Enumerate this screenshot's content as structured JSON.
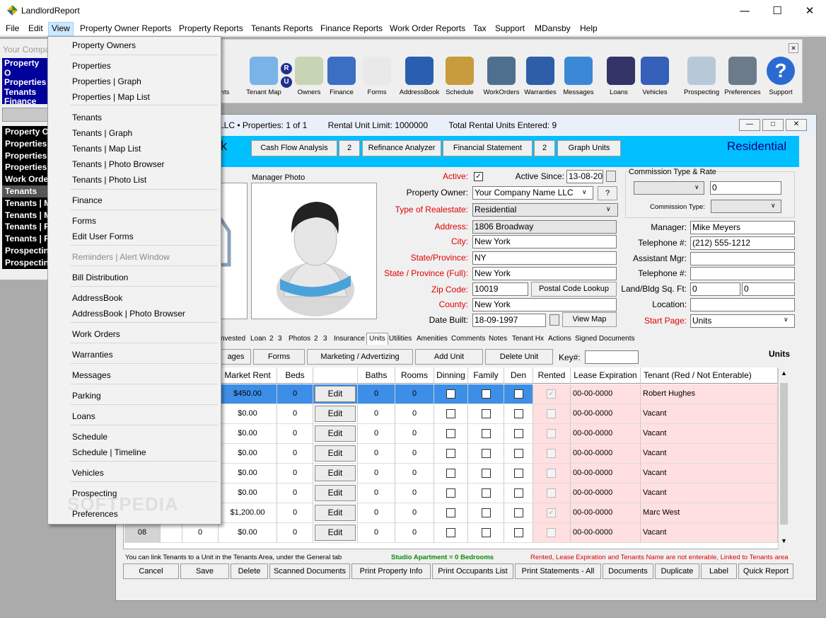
{
  "window": {
    "title": "LandlordReport"
  },
  "menu": {
    "items": [
      "File",
      "Edit",
      "View",
      "Property Owner Reports",
      "Property Reports",
      "Tenants Reports",
      "Finance Reports",
      "Work Order Reports",
      "Tax",
      "Support",
      "MDansby",
      "Help"
    ]
  },
  "view_menu": {
    "items": [
      "Property Owners",
      "Properties",
      "Properties | Graph",
      "Properties | Map List",
      "Tenants",
      "Tenants | Graph",
      "Tenants | Map List",
      "Tenants | Photo Browser",
      "Tenants | Photo List",
      "Finance",
      "Forms",
      "Edit User Forms",
      "Reminders | Alert Window",
      "Bill Distribution",
      "AddressBook",
      "AddressBook | Photo Browser",
      "Work Orders",
      "Warranties",
      "Messages",
      "Parking",
      "Loans",
      "Schedule",
      "Schedule | Timeline",
      "Vehicles",
      "Prospecting",
      "Preferences"
    ]
  },
  "left_panel": {
    "company_placeholder": "Your Compa",
    "list1": [
      "Property O",
      "Properties",
      "Tenants",
      "Finance"
    ],
    "list2": [
      "Property O",
      "Properties",
      "Properties",
      "Properties",
      "Work Orde",
      "Tenants",
      "Tenants | M",
      "Tenants | M",
      "Tenants | P",
      "Tenants | P",
      "Prospectin",
      "Prospectin"
    ]
  },
  "toolbar": {
    "items": [
      {
        "label": "nts",
        "icon": "tenants-icon"
      },
      {
        "label": "Tenant Map",
        "icon": "magnifier-icon"
      },
      {
        "label": "Owners",
        "icon": "building-icon"
      },
      {
        "label": "Finance",
        "icon": "bank-icon"
      },
      {
        "label": "Forms",
        "icon": "document-icon"
      },
      {
        "label": "AddressBook",
        "icon": "email-book-icon"
      },
      {
        "label": "Schedule",
        "icon": "notebook-icon"
      },
      {
        "label": "WorkOrders",
        "icon": "tools-icon"
      },
      {
        "label": "Warranties",
        "icon": "warranty-badge-icon"
      },
      {
        "label": "Messages",
        "icon": "phone-icon"
      },
      {
        "label": "Loans",
        "icon": "hourglass-icon"
      },
      {
        "label": "Vehicles",
        "icon": "car-icon"
      },
      {
        "label": "Prospecting",
        "icon": "skyscraper-icon"
      },
      {
        "label": "Preferences",
        "icon": "wrench-screwdriver-icon"
      },
      {
        "label": "Support",
        "icon": "help-icon"
      }
    ],
    "ru_badge": [
      "R",
      "U"
    ]
  },
  "property_window": {
    "header_left": "LLC  •  Properties: 1 of 1",
    "rental_limit": "Rental Unit Limit: 1000000",
    "total_units": "Total Rental Units Entered: 9",
    "blue_buttons": [
      "Cash Flow Analysis",
      "2",
      "Refinance Analyzer",
      "Financial Statement",
      "2",
      "Graph Units"
    ],
    "property_type_heading": "Residential",
    "manager_photo_label": "Manager Photo"
  },
  "form": {
    "active_label": "Active:",
    "active_since_label": "Active Since:",
    "active_since": "13-08-2000",
    "property_owner_label": "Property Owner:",
    "property_owner": "Your Company Name LLC",
    "owner_help": "?",
    "type_label": "Type of Realestate:",
    "type": "Residential",
    "address_label": "Address:",
    "address": "1806 Broadway",
    "city_label": "City:",
    "city": "New York",
    "state_label": "State/Province:",
    "state": "NY",
    "state_full_label": "State / Province (Full):",
    "state_full": "New York",
    "zip_label": "Zip Code:",
    "zip": "10019",
    "postal_lookup": "Postal Code Lookup",
    "county_label": "County:",
    "county": "New York",
    "date_built_label": "Date Built:",
    "date_built": "18-09-1997",
    "view_map": "View Map",
    "commission_label": "Commission Type & Rate",
    "commission_rate": "0",
    "commission_type_label": "Commission Type:",
    "manager_label": "Manager:",
    "manager": "Mike Meyers",
    "telephone_label": "Telephone #:",
    "telephone": "(212) 555-1212",
    "asst_mgr_label": "Assistant Mgr:",
    "asst_phone_label": "Telephone #:",
    "sqft_label": "Land/Bldg Sq. Ft:",
    "land_sqft": "0",
    "bldg_sqft": "0",
    "location_label": "Location:",
    "start_page_label": "Start Page:",
    "start_page": "Units"
  },
  "tabs": [
    "nvested",
    "Loan",
    "2",
    "3",
    "Photos",
    "2",
    "3",
    "Insurance",
    "Units",
    "Utilities",
    "Amenities",
    "Comments",
    "Notes",
    "Tenant Hx",
    "Actions",
    "Signed Documents"
  ],
  "units_bar": {
    "buttons": [
      "ages",
      "Forms",
      "Marketing / Advertizing",
      "Add Unit",
      "Delete Unit"
    ],
    "key_label": "Key#:",
    "title": "Units"
  },
  "grid": {
    "headers": [
      "Market Rent",
      "Beds",
      "",
      "Baths",
      "Rooms",
      "Dinning",
      "Family",
      "Den",
      "Rented",
      "Lease Expiration",
      "Tenant (Red / Not Enterable)"
    ],
    "edit_label": "Edit",
    "rows": [
      {
        "rent": "$450.00",
        "beds": "0",
        "baths": "0",
        "rooms": "0",
        "rented": true,
        "lease": "00-00-0000",
        "tenant": "Robert Hughes",
        "selected": true
      },
      {
        "rent": "$0.00",
        "beds": "0",
        "baths": "0",
        "rooms": "0",
        "rented": false,
        "lease": "00-00-0000",
        "tenant": "Vacant"
      },
      {
        "rent": "$0.00",
        "beds": "0",
        "baths": "0",
        "rooms": "0",
        "rented": false,
        "lease": "00-00-0000",
        "tenant": "Vacant"
      },
      {
        "rent": "$0.00",
        "beds": "0",
        "baths": "0",
        "rooms": "0",
        "rented": false,
        "lease": "00-00-0000",
        "tenant": "Vacant"
      },
      {
        "rent": "$0.00",
        "beds": "0",
        "baths": "0",
        "rooms": "0",
        "rented": false,
        "lease": "00-00-0000",
        "tenant": "Vacant"
      },
      {
        "rent": "$0.00",
        "beds": "0",
        "baths": "0",
        "rooms": "0",
        "rented": false,
        "lease": "00-00-0000",
        "tenant": "Vacant"
      },
      {
        "rent": "$1,200.00",
        "beds": "0",
        "baths": "0",
        "rooms": "0",
        "rented": true,
        "lease": "00-00-0000",
        "tenant": "Marc West"
      },
      {
        "unit": "08",
        "prev": "0",
        "rent": "$0.00",
        "beds": "0",
        "baths": "0",
        "rooms": "0",
        "rented": false,
        "lease": "00-00-0000",
        "tenant": "Vacant"
      }
    ]
  },
  "notes": {
    "left": "You can link Tenants to a Unit in the Tenants Area, under the General tab",
    "middle": "Studio Apartment = 0 Bedrooms",
    "right": "Rented, Lease Expiration and Tenants Name are not enterable, Linked to Tenants area"
  },
  "bottom_buttons": [
    "Cancel",
    "Save",
    "Delete",
    "Scanned Documents",
    "Print Property Info",
    "Print Occupants List",
    "Print Statements - All",
    "Documents",
    "Duplicate",
    "Label",
    "Quick Report"
  ],
  "watermark": "SOFTPEDIA",
  "colors": {
    "accent": "#00bfff",
    "selected_row": "#3d8ee6",
    "tenant_bg": "#ffdfdf",
    "required_label": "#e00000"
  }
}
